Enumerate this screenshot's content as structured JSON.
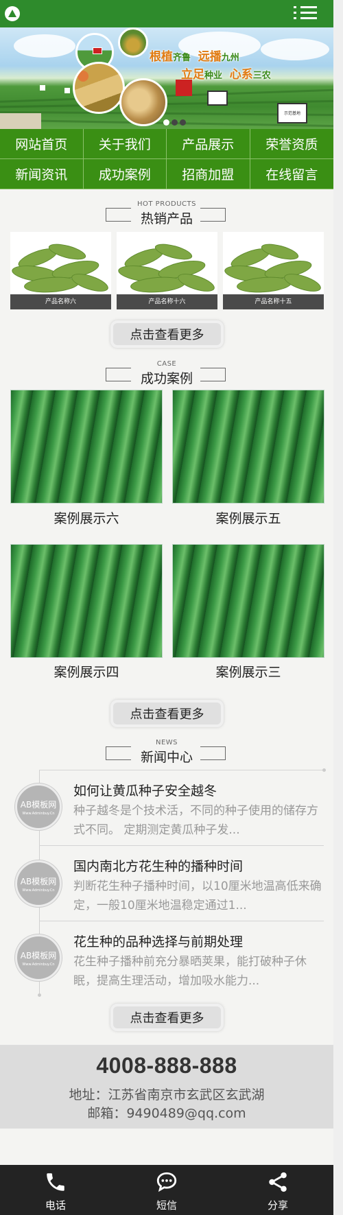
{
  "header": {
    "logo_icon": "logo-leaf-icon",
    "menu_icon": "hamburger-menu-icon",
    "bg": "#2e8b2c"
  },
  "banner": {
    "slogan_line1": [
      "根植",
      "齐鲁",
      "远播",
      "九州"
    ],
    "slogan_line2": [
      "立足",
      "种业",
      "心系",
      "三农"
    ],
    "sign_text": "示范基地",
    "slides": 3
  },
  "nav": [
    "网站首页",
    "关于我们",
    "产品展示",
    "荣誉资质",
    "新闻资讯",
    "成功案例",
    "招商加盟",
    "在线留言"
  ],
  "hot_products": {
    "title_en": "HOT PRODUCTS",
    "title_cn": "热销产品",
    "items": [
      "产品名称六",
      "产品名称十六",
      "产品名称十五"
    ],
    "more": "点击查看更多"
  },
  "cases": {
    "title_en": "CASE",
    "title_cn": "成功案例",
    "items": [
      "案例展示六",
      "案例展示五",
      "案例展示四",
      "案例展示三"
    ],
    "more": "点击查看更多"
  },
  "news": {
    "title_en": "NEWS",
    "title_cn": "新闻中心",
    "badge_text": "AB模板网",
    "badge_sub": "Www.Adminbuy.Cn",
    "items": [
      {
        "title": "如何让黄瓜种子安全越冬",
        "desc": "种子越冬是个技术活，不同的种子使用的储存方式不同。 定期测定黄瓜种子发..."
      },
      {
        "title": "国内南北方花生种的播种时间",
        "desc": "判断花生种子播种时间，以10厘米地温高低来确定，一般10厘米地温稳定通过1..."
      },
      {
        "title": "花生种的品种选择与前期处理",
        "desc": "花生种子播种前充分暴晒荚果，能打破种子休眠，提高生理活动，增加吸水能力..."
      }
    ],
    "more": "点击查看更多"
  },
  "footer": {
    "phone": "4008-888-888",
    "address": "地址：江苏省南京市玄武区玄武湖",
    "email": "邮箱：9490489@qq.com"
  },
  "bottom_bar": [
    {
      "label": "电话",
      "icon": "phone-icon"
    },
    {
      "label": "短信",
      "icon": "message-icon"
    },
    {
      "label": "分享",
      "icon": "share-icon"
    }
  ]
}
